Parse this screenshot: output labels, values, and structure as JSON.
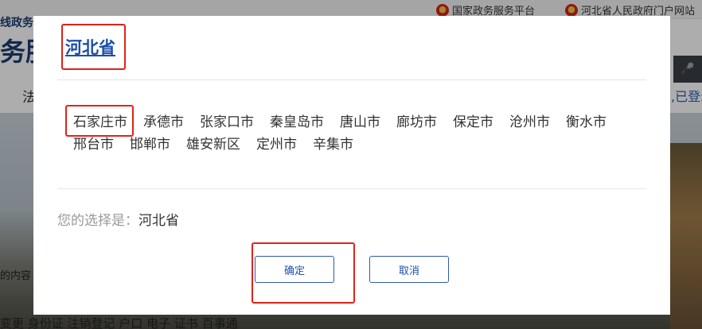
{
  "background": {
    "top_links": [
      "国家政务服务平台",
      "河北省人民政府门户网站"
    ],
    "brand_small": "线政务",
    "brand_big": "务服",
    "nav_partial": "法",
    "login_partial": ",已登录",
    "hero_left_text": "的内容",
    "services": "变更  身份证  注销登记  户口  电子  证书  百事通"
  },
  "modal": {
    "province": "河北省",
    "cities": [
      "石家庄市",
      "承德市",
      "张家口市",
      "秦皇岛市",
      "唐山市",
      "廊坊市",
      "保定市",
      "沧州市",
      "衡水市",
      "邢台市",
      "邯郸市",
      "雄安新区",
      "定州市",
      "辛集市"
    ],
    "choice_label": "您的选择是：",
    "choice_value": "河北省",
    "confirm_label": "确定",
    "cancel_label": "取消"
  },
  "colors": {
    "accent": "#1b4fa8",
    "highlight": "#e0231a"
  }
}
